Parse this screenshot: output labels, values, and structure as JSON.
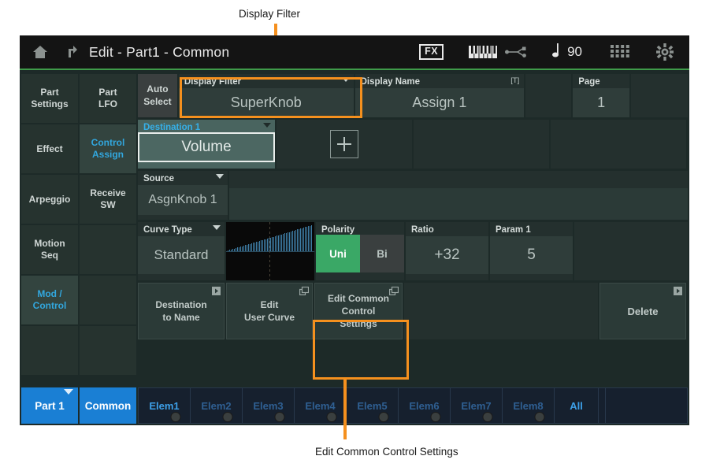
{
  "annotations": {
    "top": {
      "label": "Display Filter"
    },
    "bottom": {
      "label": "Edit Common Control Settings"
    }
  },
  "titlebar": {
    "home_icon": "home-icon",
    "up_icon": "exit-up-icon",
    "title": "Edit - Part1 - Common",
    "fx_badge": "FX",
    "keyboard_icon": "keyboard-icon",
    "usb_icon": "usb-icon",
    "note_icon": "quarter-note-icon",
    "tempo": "90",
    "grid_icon": "grid-icon",
    "gear_icon": "gear-icon"
  },
  "nav": {
    "items": [
      {
        "label": "Part\nSettings",
        "selected": false
      },
      {
        "label": "Part\nLFO",
        "selected": false
      },
      {
        "label": "Effect",
        "selected": false
      },
      {
        "label": "Control\nAssign",
        "selected": true
      },
      {
        "label": "Arpeggio",
        "selected": false
      },
      {
        "label": "Receive\nSW",
        "selected": false
      },
      {
        "label": "Motion\nSeq",
        "selected": false
      },
      {
        "label": "",
        "selected": false
      },
      {
        "label": "Mod /\nControl",
        "selected": true
      },
      {
        "label": "",
        "selected": false
      },
      {
        "label": "",
        "selected": false
      },
      {
        "label": "",
        "selected": false
      }
    ]
  },
  "main": {
    "auto_select": "Auto\nSelect",
    "display_filter": {
      "label": "Display Filter",
      "value": "SuperKnob"
    },
    "display_name": {
      "label": "Display Name",
      "value": "Assign 1",
      "badge": "[T]"
    },
    "page": {
      "label": "Page",
      "value": "1"
    },
    "destination": {
      "label": "Destination 1",
      "value": "Volume"
    },
    "add_icon": "plus-icon",
    "source": {
      "label": "Source",
      "value": "AsgnKnob 1"
    },
    "curve_type": {
      "label": "Curve Type",
      "value": "Standard"
    },
    "polarity": {
      "label": "Polarity",
      "uni": "Uni",
      "bi": "Bi",
      "selected": "Uni"
    },
    "ratio": {
      "label": "Ratio",
      "value": "+32"
    },
    "param1": {
      "label": "Param 1",
      "value": "5"
    },
    "buttons": [
      {
        "label": "Destination\nto Name",
        "corner_icon": "jump-icon"
      },
      {
        "label": "Edit\nUser Curve",
        "corner_icon": "window-icon"
      },
      {
        "label": "Edit Common\nControl\nSettings",
        "corner_icon": "window-icon"
      }
    ],
    "delete_button": {
      "label": "Delete",
      "corner_icon": "jump-icon"
    }
  },
  "tabbar": {
    "part_tab": "Part 1",
    "common_tab": "Common",
    "elements": [
      {
        "label": "Elem1",
        "active": true
      },
      {
        "label": "Elem2",
        "active": false
      },
      {
        "label": "Elem3",
        "active": false
      },
      {
        "label": "Elem4",
        "active": false
      },
      {
        "label": "Elem5",
        "active": false
      },
      {
        "label": "Elem6",
        "active": false
      },
      {
        "label": "Elem7",
        "active": false
      },
      {
        "label": "Elem8",
        "active": false
      }
    ],
    "all_tab": "All"
  },
  "colors": {
    "accent_orange": "#f5901e",
    "accent_blue": "#1a7fd4",
    "cyan_text": "#36b0e8",
    "green_on": "#3aa866",
    "panel_dark": "#24302e",
    "panel_value": "#2f3d3a",
    "screen_bg": "#1d2a28"
  }
}
